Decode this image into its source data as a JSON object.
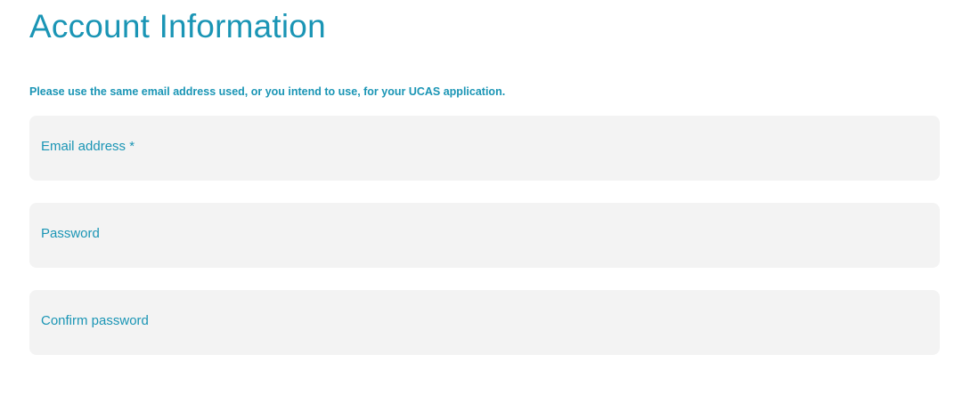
{
  "header": {
    "title": "Account Information"
  },
  "notice": {
    "text": "Please use the same email address used, or you intend to use, for your UCAS application."
  },
  "form": {
    "fields": [
      {
        "label": "Email address *",
        "value": ""
      },
      {
        "label": "Password",
        "value": ""
      },
      {
        "label": "Confirm password",
        "value": ""
      }
    ]
  },
  "colors": {
    "accent": "#1a95b5",
    "field_background": "#f3f3f3",
    "page_background": "#ffffff"
  }
}
